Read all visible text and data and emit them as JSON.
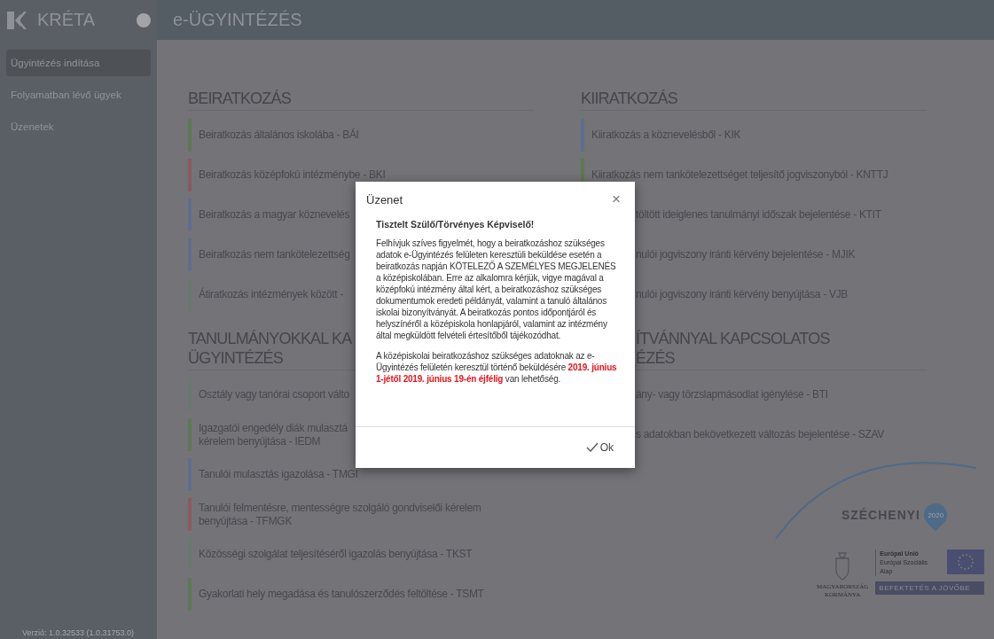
{
  "sidebar": {
    "brand": "KRÉTA",
    "items": [
      {
        "label": "Ügyintézés indítása",
        "selected": true
      },
      {
        "label": "Folyamatban lévő ügyek",
        "selected": false
      },
      {
        "label": "Üzenetek",
        "selected": false
      }
    ],
    "version": "Verzió: 1.0.32533 (1.0.31753.0)"
  },
  "header": {
    "title": "e-ÜGYINTÉZÉS"
  },
  "columns": [
    {
      "sections": [
        {
          "heading": [
            "BEIRATKOZÁS"
          ],
          "items": [
            {
              "kind": "full",
              "color": "#5c7a52",
              "lines": [
                "Beiratkozás általános iskolába - BÁI"
              ]
            },
            {
              "kind": "full",
              "color": "#8a5a5e",
              "lines": [
                "Beiratkozás középfokú intézménybe - BKI"
              ]
            },
            {
              "kind": "full",
              "color": "#5c6f8c",
              "lines": [
                "Beiratkozás a magyar köznevelés"
              ]
            },
            {
              "kind": "full",
              "color": "#5c6f8c",
              "lines": [
                "Beiratkozás nem tankötelezettség"
              ]
            },
            {
              "kind": "full",
              "color": "#667a6e",
              "lines": [
                "Átiratkozás intézmények között -"
              ]
            }
          ]
        },
        {
          "heading": [
            "TANULMÁNYOKKAL KA",
            "ÜGYINTÉZÉS"
          ],
          "items": [
            {
              "kind": "full",
              "color": "#667a6e",
              "lines": [
                "Osztály vagy tanórai csoport válto"
              ]
            },
            {
              "kind": "full",
              "color": "#5c7a52",
              "lines": [
                "Igazgatói engedély diák mulasztá",
                "kérelem benyújtása - IEDM"
              ]
            },
            {
              "kind": "full",
              "color": "#5c6f8c",
              "lines": [
                "Tanulói mulasztás igazolása - TMGI"
              ]
            },
            {
              "kind": "full",
              "color": "#8a5a5e",
              "lines": [
                "Tanulói felmentésre, mentességre szolgáló gondviselői kérelem",
                "benyújtása - TFMGK"
              ]
            },
            {
              "kind": "full",
              "color": "#667a6e",
              "lines": [
                "Közösségi szolgálat teljesítéséről igazolás benyújtása - TKST"
              ]
            },
            {
              "kind": "full",
              "color": "#5c7a52",
              "lines": [
                "Gyakorlati hely megadása és tanulószerződés feltöltése - TSMT"
              ]
            }
          ]
        }
      ]
    },
    {
      "sections": [
        {
          "heading": [
            "KIIRATKOZÁS"
          ],
          "items": [
            {
              "kind": "full",
              "color": "#5c6f8c",
              "lines": [
                "Kiiratkozás a köznevelésből - KIK"
              ]
            },
            {
              "kind": "full",
              "color": "#5c7a52",
              "lines": [
                "Kiiratkozás nem tankötelezettséget teljesítő jogviszonyból - KNTTJ"
              ]
            },
            {
              "kind": "cut",
              "lines": [
                "töltött ideiglenes tanulmányi időszak bejelentése - KTIT"
              ]
            },
            {
              "kind": "cut",
              "lines": [
                "nulói jogviszony iránti kérvény bejelentése - MJIK"
              ]
            },
            {
              "kind": "cut",
              "lines": [
                "nulói jogviszony iránti kérvény benyújtása - VJB"
              ]
            }
          ]
        },
        {
          "heading": [
            "ÍTVÁNNYAL KAPCSOLATOS",
            "ÉZÉS"
          ],
          "cut": true,
          "items": [
            {
              "kind": "cut",
              "lines": [
                "ány- vagy törzslapmásodlat igénylése - BTI"
              ]
            },
            {
              "kind": "cut",
              "lines": [
                "s adatokban bekövetkezett változás bejelentése - SZAV"
              ]
            }
          ]
        }
      ]
    }
  ],
  "logos": {
    "szechenyi": "SZÉCHENYI",
    "year": "2020",
    "eu_lines": [
      "Európai Unió",
      "Európai Szociális",
      "Alap"
    ],
    "gov_lines": [
      "MAGYARORSZÁG",
      "KORMÁNYA"
    ],
    "slogan": "BEFEKTETÉS A JÖVŐBE"
  },
  "dialog": {
    "title": "Üzenet",
    "close": "×",
    "greeting": "Tisztelt Szülő/Törvényes Képviselő!",
    "paragraphs": [
      "Felhívjuk szíves figyelmét, hogy a beiratkozáshoz szükséges adatok e-Ügyintézés felületen keresztüli beküldése esetén a beiratkozás napján KÖTELEZŐ A SZEMÉLYES MEGJELENÉS a középiskolában. Erre az alkalomra kérjük, vigye magával a középfokú intézmény által kért, a beiratkozáshoz szükséges dokumentumok eredeti példányát, valamint a tanuló általános iskolai bizonyítványát. A beiratkozás pontos időpontjáról és helyszínéről a középiskola honlapjáról, valamint az intézmény által megküldött felvételi értesítőből tájékozódhat.",
      "A középiskolai beiratkozáshoz szükséges adatoknak az e-Ügyintézés felületén keresztül történő beküldésére **2019. június 1-jétől 2019. június 19-én éjfélig** van lehetőség."
    ],
    "ok": "Ok"
  }
}
